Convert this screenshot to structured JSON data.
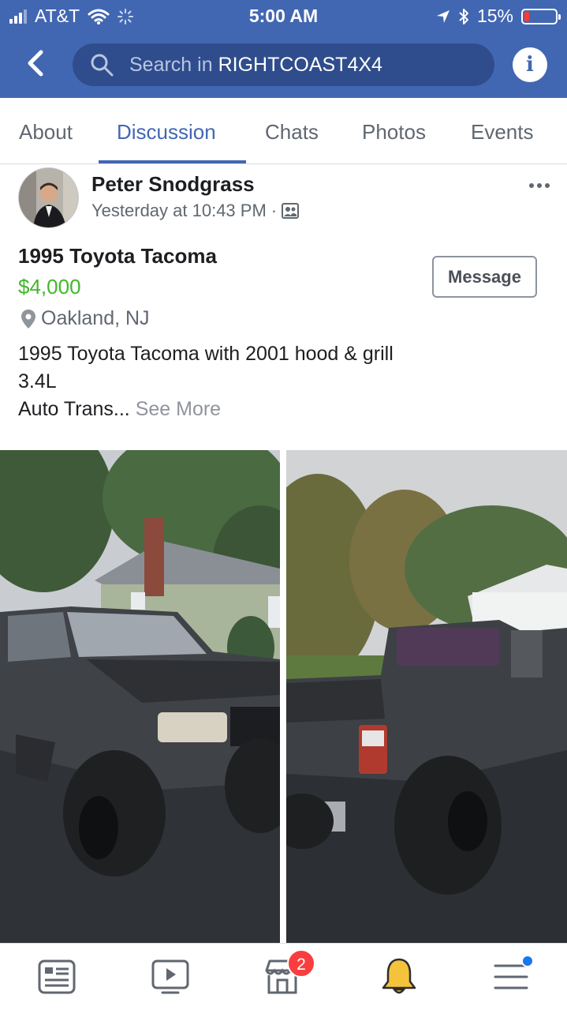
{
  "status_bar": {
    "carrier": "AT&T",
    "time": "5:00 AM",
    "battery": "15%",
    "battery_level": 0.15
  },
  "header": {
    "search_prefix": "Search in ",
    "search_group": "RIGHTCOAST4X4",
    "info_label": "i"
  },
  "tabs": [
    {
      "label": "About",
      "active": false
    },
    {
      "label": "Discussion",
      "active": true
    },
    {
      "label": "Chats",
      "active": false
    },
    {
      "label": "Photos",
      "active": false
    },
    {
      "label": "Events",
      "active": false
    }
  ],
  "post": {
    "author": "Peter Snodgrass",
    "timestamp": "Yesterday at 10:43 PM",
    "separator": "·",
    "listing": {
      "title": "1995 Toyota Tacoma",
      "price": "$4,000",
      "location": "Oakland, NJ",
      "message_button": "Message"
    },
    "description_lines": [
      "1995 Toyota Tacoma with 2001 hood & grill",
      "3.4L",
      "Auto Trans..."
    ],
    "see_more": "See More"
  },
  "bottom_nav": {
    "items": [
      "news-feed-icon",
      "watch-icon",
      "marketplace-icon",
      "notifications-icon",
      "menu-icon"
    ],
    "marketplace_badge": "2"
  },
  "colors": {
    "brand_blue": "#4267b2",
    "price_green": "#42b72a",
    "badge_red": "#fa3e3e",
    "bell_yellow": "#f5c33b"
  }
}
